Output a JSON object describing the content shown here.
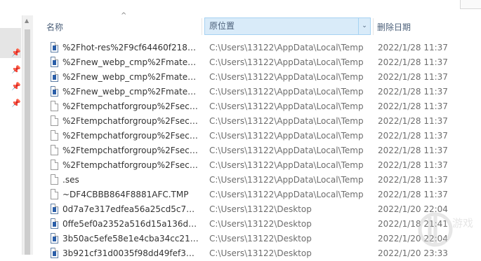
{
  "header": {
    "name_label": "名称",
    "location_label": "原位置",
    "date_label": "删除日期"
  },
  "files": [
    {
      "name": "%2Fhot-res%2F9cf64460f21820...",
      "location": "C:\\Users\\13122\\AppData\\Local\\Temp",
      "date": "2022/1/28 11:37",
      "icon": "image-file-icon"
    },
    {
      "name": "%2Fnew_webp_cmp%2Fmaterial...",
      "location": "C:\\Users\\13122\\AppData\\Local\\Temp",
      "date": "2022/1/28 11:37",
      "icon": "image-file-icon"
    },
    {
      "name": "%2Fnew_webp_cmp%2Fmaterial...",
      "location": "C:\\Users\\13122\\AppData\\Local\\Temp",
      "date": "2022/1/28 11:37",
      "icon": "image-file-icon"
    },
    {
      "name": "%2Fnew_webp_cmp%2Fmaterial...",
      "location": "C:\\Users\\13122\\AppData\\Local\\Temp",
      "date": "2022/1/28 11:37",
      "icon": "image-file-icon"
    },
    {
      "name": "%2Ftempchatforgroup%2Fsecu...",
      "location": "C:\\Users\\13122\\AppData\\Local\\Temp",
      "date": "2022/1/28 11:37",
      "icon": "blank-file-icon"
    },
    {
      "name": "%2Ftempchatforgroup%2Fsecu...",
      "location": "C:\\Users\\13122\\AppData\\Local\\Temp",
      "date": "2022/1/28 11:37",
      "icon": "blank-file-icon"
    },
    {
      "name": "%2Ftempchatforgroup%2Fsecu...",
      "location": "C:\\Users\\13122\\AppData\\Local\\Temp",
      "date": "2022/1/28 11:37",
      "icon": "blank-file-icon"
    },
    {
      "name": "%2Ftempchatforgroup%2Fsecu...",
      "location": "C:\\Users\\13122\\AppData\\Local\\Temp",
      "date": "2022/1/28 11:37",
      "icon": "blank-file-icon"
    },
    {
      "name": "%2Ftempchatforgroup%2Fsecu...",
      "location": "C:\\Users\\13122\\AppData\\Local\\Temp",
      "date": "2022/1/28 11:37",
      "icon": "blank-file-icon"
    },
    {
      "name": ".ses",
      "location": "C:\\Users\\13122\\AppData\\Local\\Temp",
      "date": "2022/1/28 11:37",
      "icon": "blank-file-icon"
    },
    {
      "name": "~DF4CBBB864F8881AFC.TMP",
      "location": "C:\\Users\\13122\\AppData\\Local\\Temp",
      "date": "2022/1/28 11:37",
      "icon": "blank-file-icon"
    },
    {
      "name": "0d7a7e317edfea56a25cd5c7e2...",
      "location": "C:\\Users\\13122\\Desktop",
      "date": "2022/1/20 22:04",
      "icon": "image-file-icon"
    },
    {
      "name": "0ffe5ef0a2352a516d15a136dab...",
      "location": "C:\\Users\\13122\\Desktop",
      "date": "2022/1/18 21:41",
      "icon": "image-file-icon"
    },
    {
      "name": "3b50ac5efe58e1e4cba34cc21ee...",
      "location": "C:\\Users\\13122\\Desktop",
      "date": "2022/1/20 22:04",
      "icon": "image-file-icon"
    },
    {
      "name": "3b921cf31d0035f98dd49fef336...",
      "location": "C:\\Users\\13122\\Desktop",
      "date": "2022/1/20 23:33",
      "icon": "image-file-icon"
    }
  ]
}
